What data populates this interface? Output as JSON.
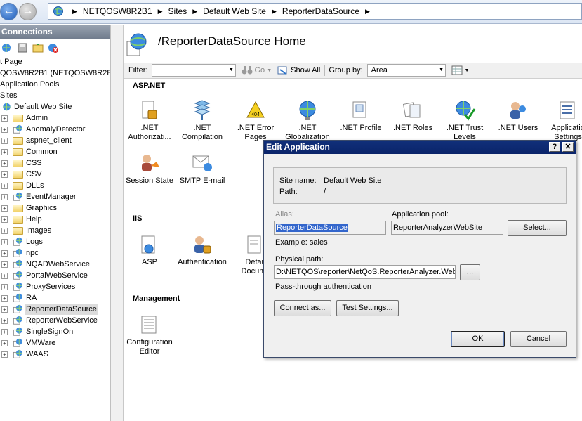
{
  "addressbar": {
    "crumbs": [
      "NETQOSW8R2B1",
      "Sites",
      "Default Web Site",
      "ReporterDataSource"
    ]
  },
  "connections": {
    "title": "Connections",
    "start_page": "t Page",
    "server": "QOSW8R2B1 (NETQOSW8R2B1\\",
    "app_pools": "Application Pools",
    "sites": "Sites",
    "default_site": "Default Web Site",
    "items": [
      "Admin",
      "AnomalyDetector",
      "aspnet_client",
      "Common",
      "CSS",
      "CSV",
      "DLLs",
      "EventManager",
      "Graphics",
      "Help",
      "Images",
      "Logs",
      "npc",
      "NQADWebService",
      "PortalWebService",
      "ProxyServices",
      "RA",
      "ReporterDataSource",
      "ReporterWebService",
      "SingleSignOn",
      "VMWare",
      "WAAS"
    ],
    "selected": "ReporterDataSource"
  },
  "main": {
    "title": "/ReporterDataSource Home",
    "filter_label": "Filter:",
    "go_label": "Go",
    "show_all_label": "Show All",
    "group_by_label": "Group by:",
    "group_by_value": "Area",
    "sections": {
      "aspnet": "ASP.NET",
      "iis": "IIS",
      "management": "Management"
    },
    "aspnet_features": [
      {
        "l1": ".NET",
        "l2": "Authorizati..."
      },
      {
        "l1": ".NET",
        "l2": "Compilation"
      },
      {
        "l1": ".NET Error",
        "l2": "Pages"
      },
      {
        "l1": ".NET",
        "l2": "Globalization"
      },
      {
        "l1": ".NET Profile",
        "l2": ""
      },
      {
        "l1": ".NET Roles",
        "l2": ""
      },
      {
        "l1": ".NET Trust",
        "l2": "Levels"
      },
      {
        "l1": ".NET Users",
        "l2": ""
      },
      {
        "l1": "Applicatio",
        "l2": "Settings"
      }
    ],
    "aspnet_row2": [
      {
        "l1": "Session State",
        "l2": ""
      },
      {
        "l1": "SMTP E-mail",
        "l2": ""
      }
    ],
    "iis_features": [
      {
        "l1": "ASP",
        "l2": ""
      },
      {
        "l1": "Authentication",
        "l2": ""
      },
      {
        "l1": "Defau",
        "l2": "Docume"
      }
    ],
    "management_features": [
      {
        "l1": "Configuration",
        "l2": "Editor"
      }
    ]
  },
  "dialog": {
    "title": "Edit Application",
    "site_name_label": "Site name:",
    "site_name_value": "Default Web Site",
    "path_label": "Path:",
    "path_value": "/",
    "alias_label": "Alias:",
    "alias_value": "ReporterDataSource",
    "app_pool_label": "Application pool:",
    "app_pool_value": "ReporterAnalyzerWebSite",
    "select_button": "Select...",
    "example": "Example: sales",
    "physical_path_label": "Physical path:",
    "physical_path_value": "D:\\NETQOS\\reporter\\NetQoS.ReporterAnalyzer.Web",
    "browse_button": "...",
    "passthrough": "Pass-through authentication",
    "connect_as_button": "Connect as...",
    "test_settings_button": "Test Settings...",
    "ok_button": "OK",
    "cancel_button": "Cancel",
    "help_glyph": "?",
    "close_glyph": "✕"
  }
}
